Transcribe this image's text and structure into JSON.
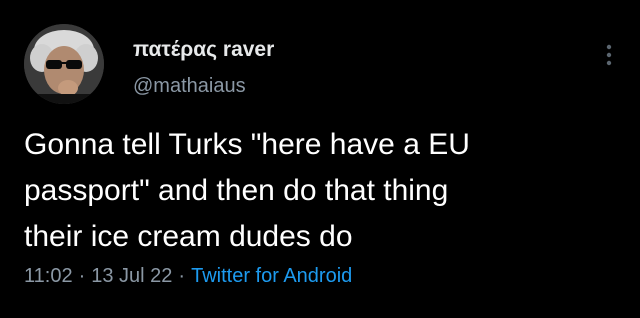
{
  "user": {
    "display_name": "πατέρας raver",
    "handle": "@mathaiaus"
  },
  "tweet": {
    "text": "Gonna tell Turks \"here have a EU\npassport\" and then do that thing\ntheir ice cream dudes do",
    "time": "11:02",
    "separator": "·",
    "date": "13 Jul 22",
    "source": "Twitter for Android"
  },
  "icons": {
    "more": "more-vertical-icon",
    "avatar": "avatar"
  },
  "colors": {
    "background": "#000000",
    "text": "#ffffff",
    "secondary": "#8b98a5",
    "link": "#1d9bf0"
  }
}
